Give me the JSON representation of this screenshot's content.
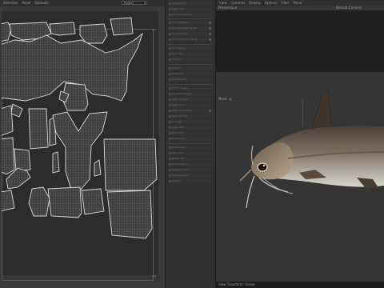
{
  "uv_editor": {
    "menu": [
      "Selection",
      "Panel",
      "Subtools"
    ],
    "channel_select": "Project",
    "tile_corner_label": "1.0",
    "tile_bottom_label": "1.0"
  },
  "tools": {
    "rows": [
      "Select Polys",
      "Relax UVs",
      "Pack Rectangular",
      "UV Straighten",
      "UV Straighten Partial",
      "UV Snapping",
      "UV Snapping Overlap",
      "UV Unwrap",
      "Pack UVs",
      "Mirror U",
      "Mirror V",
      "Rotate 90",
      "UV Fit Width",
      "UV Fit Height",
      "Align Horizontal",
      "Align Vertical",
      "Relax Grid",
      "Relax UV Islands",
      "Stack Similar",
      "Unstack",
      "Scale UVs",
      "Move UVs",
      "Rotate UVs",
      "Distribute",
      "Weld UVs",
      "Break UVs",
      "Select Island",
      "Select Seams",
      "Select Border",
      "Project"
    ]
  },
  "viewport": {
    "menu": [
      "View",
      "Cameras",
      "Display",
      "Options",
      "Filter",
      "Panel"
    ],
    "label_left": "Perspective",
    "label_camera": "Default Camera",
    "label_move": "Move",
    "status_text": "View Transform: Scene"
  }
}
